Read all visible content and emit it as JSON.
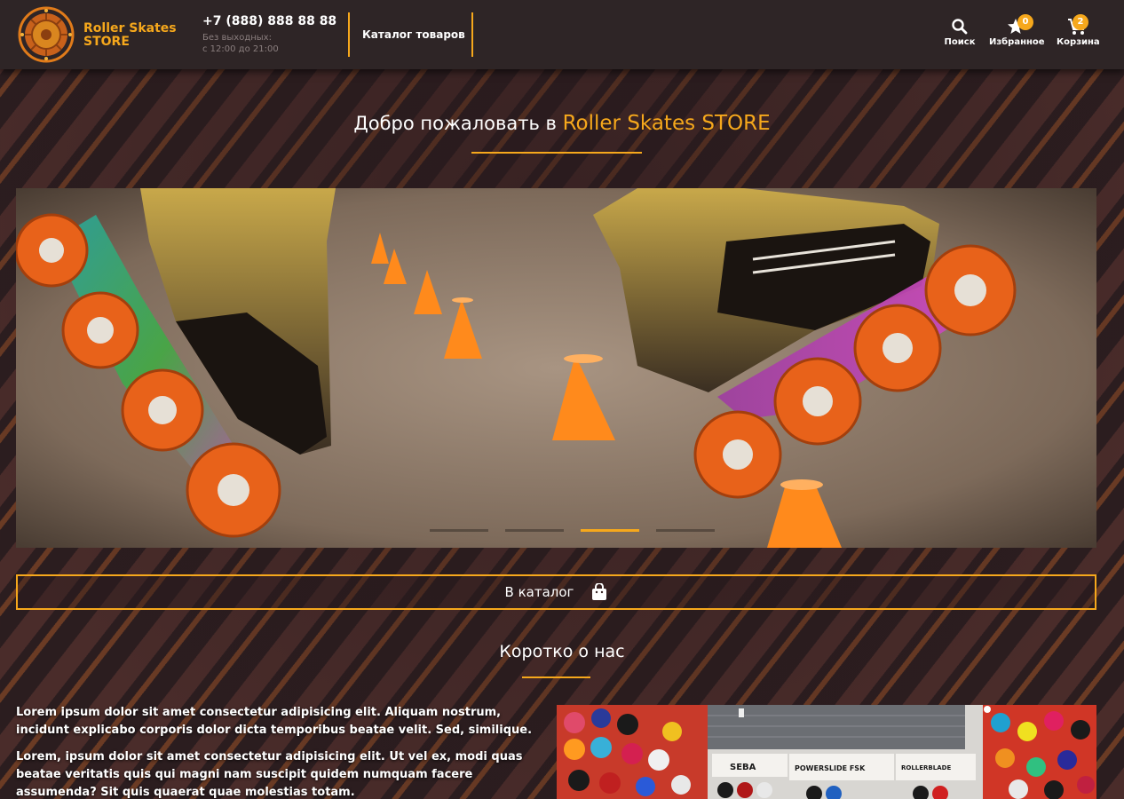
{
  "header": {
    "brand_line1": "Roller Skates",
    "brand_line2": "STORE",
    "phone": "+7 (888) 888 88 88",
    "hours_line1": "Без выходных:",
    "hours_line2": "с 12:00 до 21:00",
    "catalog_link": "Каталог товаров",
    "actions": {
      "search_label": "Поиск",
      "favorites_label": "Избранное",
      "favorites_count": "0",
      "cart_label": "Корзина",
      "cart_count": "2"
    }
  },
  "welcome": {
    "prefix": "Добро пожаловать в",
    "brand": "Roller Skates STORE"
  },
  "slider": {
    "slide_count": 4,
    "active_index": 2
  },
  "catalog_button": {
    "label": "В каталог"
  },
  "about": {
    "title": "Коротко о нас",
    "paragraph1": "Lorem ipsum dolor sit amet consectetur adipisicing elit. Aliquam nostrum, incidunt explicabo corporis dolor dicta temporibus beatae velit. Sed, similique.",
    "paragraph2": "Lorem, ipsum dolor sit amet consectetur adipisicing elit. Ut vel ex, modi quas beatae veritatis quis qui magni nam suscipit quidem numquam facere assumenda? Sit quis quaerat quae molestias totam.",
    "store_signs": [
      "SEBA",
      "POWERSLIDE FSK",
      "ROLLERBLADE"
    ]
  },
  "colors": {
    "accent": "#f6a81c",
    "header_bg": "#2e2526",
    "text": "#ffffff"
  }
}
